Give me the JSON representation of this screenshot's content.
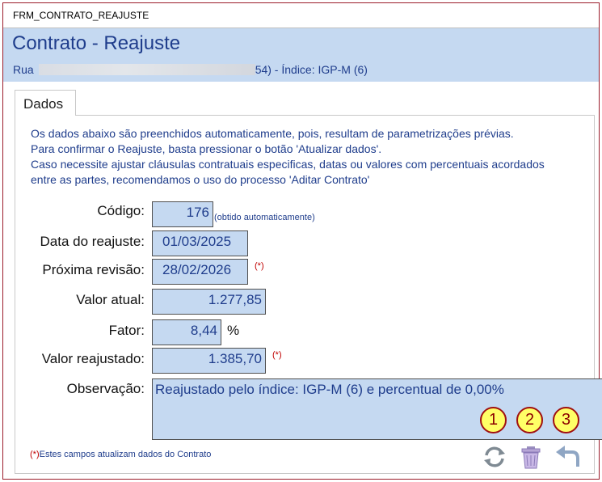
{
  "window": {
    "title": "FRM_CONTRATO_REAJUSTE"
  },
  "header": {
    "title": "Contrato - Reajuste",
    "address_prefix": "Rua",
    "address_suffix": "54) - Índice: IGP-M (6)"
  },
  "tabs": [
    {
      "label": "Dados"
    }
  ],
  "info_lines": [
    "Os dados abaixo são preenchidos automaticamente, pois, resultam de parametrizações prévias.",
    "Para confirmar o Reajuste, basta pressionar o botão 'Atualizar dados'.",
    "Caso necessite ajustar cláusulas contratuais especificas, datas ou valores com percentuais acordados",
    "entre as partes, recomendamos o uso do processo 'Aditar Contrato'"
  ],
  "form": {
    "codigo": {
      "label": "Código:",
      "value": "176",
      "note": "(obtido automaticamente)"
    },
    "data_reajuste": {
      "label": "Data do reajuste:",
      "value": "01/03/2025"
    },
    "proxima_revisao": {
      "label": "Próxima revisão:",
      "value": "28/02/2026",
      "marker": "(*)"
    },
    "valor_atual": {
      "label": "Valor atual:",
      "value": "1.277,85"
    },
    "fator": {
      "label": "Fator:",
      "value": "8,44",
      "unit": "%"
    },
    "valor_reajustado": {
      "label": "Valor reajustado:",
      "value": "1.385,70",
      "marker": "(*)"
    },
    "observacao": {
      "label": "Observação:",
      "value": "Reajustado pelo índice: IGP-M (6) e percentual de 0,00%"
    }
  },
  "footnote": {
    "marker": "(*)",
    "text": "Estes campos atualizam dados do Contrato"
  },
  "actions": [
    {
      "badge": "1",
      "icon": "refresh-icon"
    },
    {
      "badge": "2",
      "icon": "trash-icon"
    },
    {
      "badge": "3",
      "icon": "undo-arrow-icon"
    }
  ],
  "colors": {
    "header_bg": "#c5d9f1",
    "accent_text": "#1f3d8c",
    "marker_red": "#c00000",
    "badge_fill": "#ffff66",
    "window_border": "#9b1c2a"
  }
}
